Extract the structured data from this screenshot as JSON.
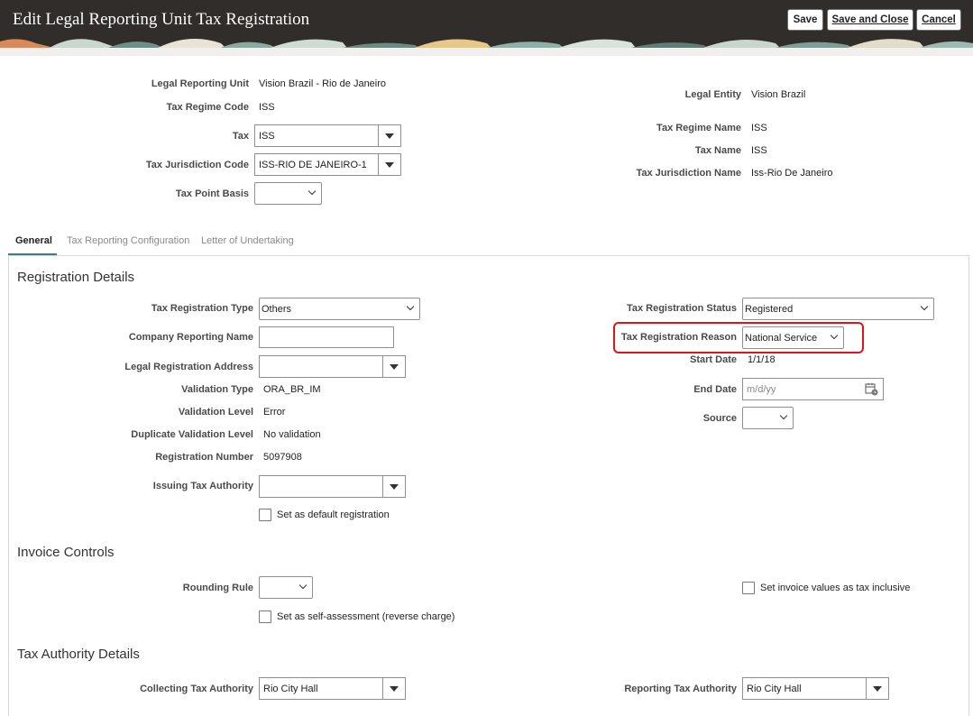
{
  "header": {
    "title": "Edit Legal Reporting Unit Tax Registration",
    "save_label": "Save",
    "save_close_label": "Save and Close",
    "cancel_label": "Cancel"
  },
  "top": {
    "legal_reporting_unit": {
      "label": "Legal Reporting Unit",
      "value": "Vision Brazil - Rio de Janeiro"
    },
    "tax_regime_code": {
      "label": "Tax Regime Code",
      "value": "ISS"
    },
    "tax": {
      "label": "Tax",
      "value": "ISS"
    },
    "tax_jurisdiction_code": {
      "label": "Tax Jurisdiction Code",
      "value": "ISS-RIO DE JANEIRO-1"
    },
    "tax_point_basis": {
      "label": "Tax Point Basis",
      "value": ""
    },
    "legal_entity": {
      "label": "Legal Entity",
      "value": "Vision Brazil"
    },
    "tax_regime_name": {
      "label": "Tax Regime Name",
      "value": "ISS"
    },
    "tax_name": {
      "label": "Tax Name",
      "value": "ISS"
    },
    "tax_jurisdiction_name": {
      "label": "Tax Jurisdiction Name",
      "value": "Iss-Rio De Janeiro"
    }
  },
  "tabs": [
    "General",
    "Tax Reporting Configuration",
    "Letter of Undertaking"
  ],
  "registration": {
    "heading": "Registration Details",
    "type": {
      "label": "Tax Registration Type",
      "value": "Others"
    },
    "company_reporting_name": {
      "label": "Company Reporting Name",
      "value": ""
    },
    "legal_registration_address": {
      "label": "Legal Registration Address",
      "value": ""
    },
    "validation_type": {
      "label": "Validation Type",
      "value": "ORA_BR_IM"
    },
    "validation_level": {
      "label": "Validation Level",
      "value": "Error"
    },
    "duplicate_validation_level": {
      "label": "Duplicate Validation Level",
      "value": "No validation"
    },
    "registration_number": {
      "label": "Registration Number",
      "value": "5097908"
    },
    "issuing_tax_authority": {
      "label": "Issuing Tax Authority",
      "value": ""
    },
    "default_registration": {
      "label": "Set as default registration",
      "checked": false
    },
    "status": {
      "label": "Tax Registration Status",
      "value": "Registered"
    },
    "reason": {
      "label": "Tax Registration Reason",
      "value": "National Service"
    },
    "start_date": {
      "label": "Start Date",
      "value": "1/1/18"
    },
    "end_date": {
      "label": "End Date",
      "placeholder": "m/d/yy"
    },
    "source": {
      "label": "Source",
      "value": ""
    }
  },
  "invoice": {
    "heading": "Invoice Controls",
    "rounding_rule": {
      "label": "Rounding Rule",
      "value": ""
    },
    "self_assessment": {
      "label": "Set as self-assessment (reverse charge)",
      "checked": false
    },
    "tax_inclusive": {
      "label": "Set invoice values as tax inclusive",
      "checked": false
    }
  },
  "authority": {
    "heading": "Tax Authority Details",
    "collecting": {
      "label": "Collecting Tax Authority",
      "value": "Rio City Hall"
    },
    "reporting": {
      "label": "Reporting Tax Authority",
      "value": "Rio City Hall"
    }
  },
  "colors": {
    "header_bg": "#312d2a",
    "tab_accent": "#3a7f86",
    "highlight": "#e0131a"
  }
}
